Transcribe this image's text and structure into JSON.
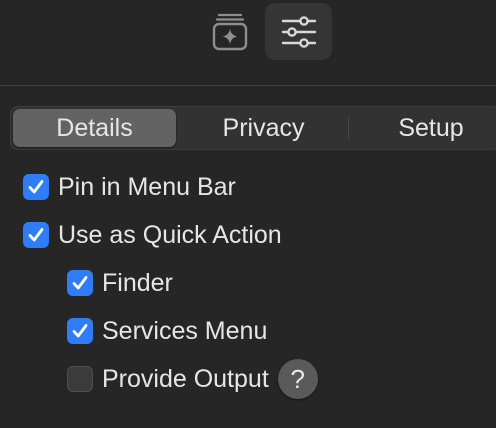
{
  "toolbar": {
    "items": [
      {
        "icon": "shortcut-sparkle-icon",
        "selected": false
      },
      {
        "icon": "sliders-icon",
        "selected": true
      }
    ]
  },
  "tabs": {
    "items": [
      {
        "label": "Details",
        "selected": true
      },
      {
        "label": "Privacy",
        "selected": false
      },
      {
        "label": "Setup",
        "selected": false
      }
    ]
  },
  "options": {
    "pin_menu_bar": {
      "label": "Pin in Menu Bar",
      "checked": true
    },
    "quick_action": {
      "label": "Use as Quick Action",
      "checked": true
    },
    "finder": {
      "label": "Finder",
      "checked": true
    },
    "services_menu": {
      "label": "Services Menu",
      "checked": true
    },
    "provide_output": {
      "label": "Provide Output",
      "checked": false
    },
    "help_glyph": "?"
  },
  "colors": {
    "background": "#262626",
    "accent": "#2f7cf6",
    "segment_selected": "#636363"
  }
}
